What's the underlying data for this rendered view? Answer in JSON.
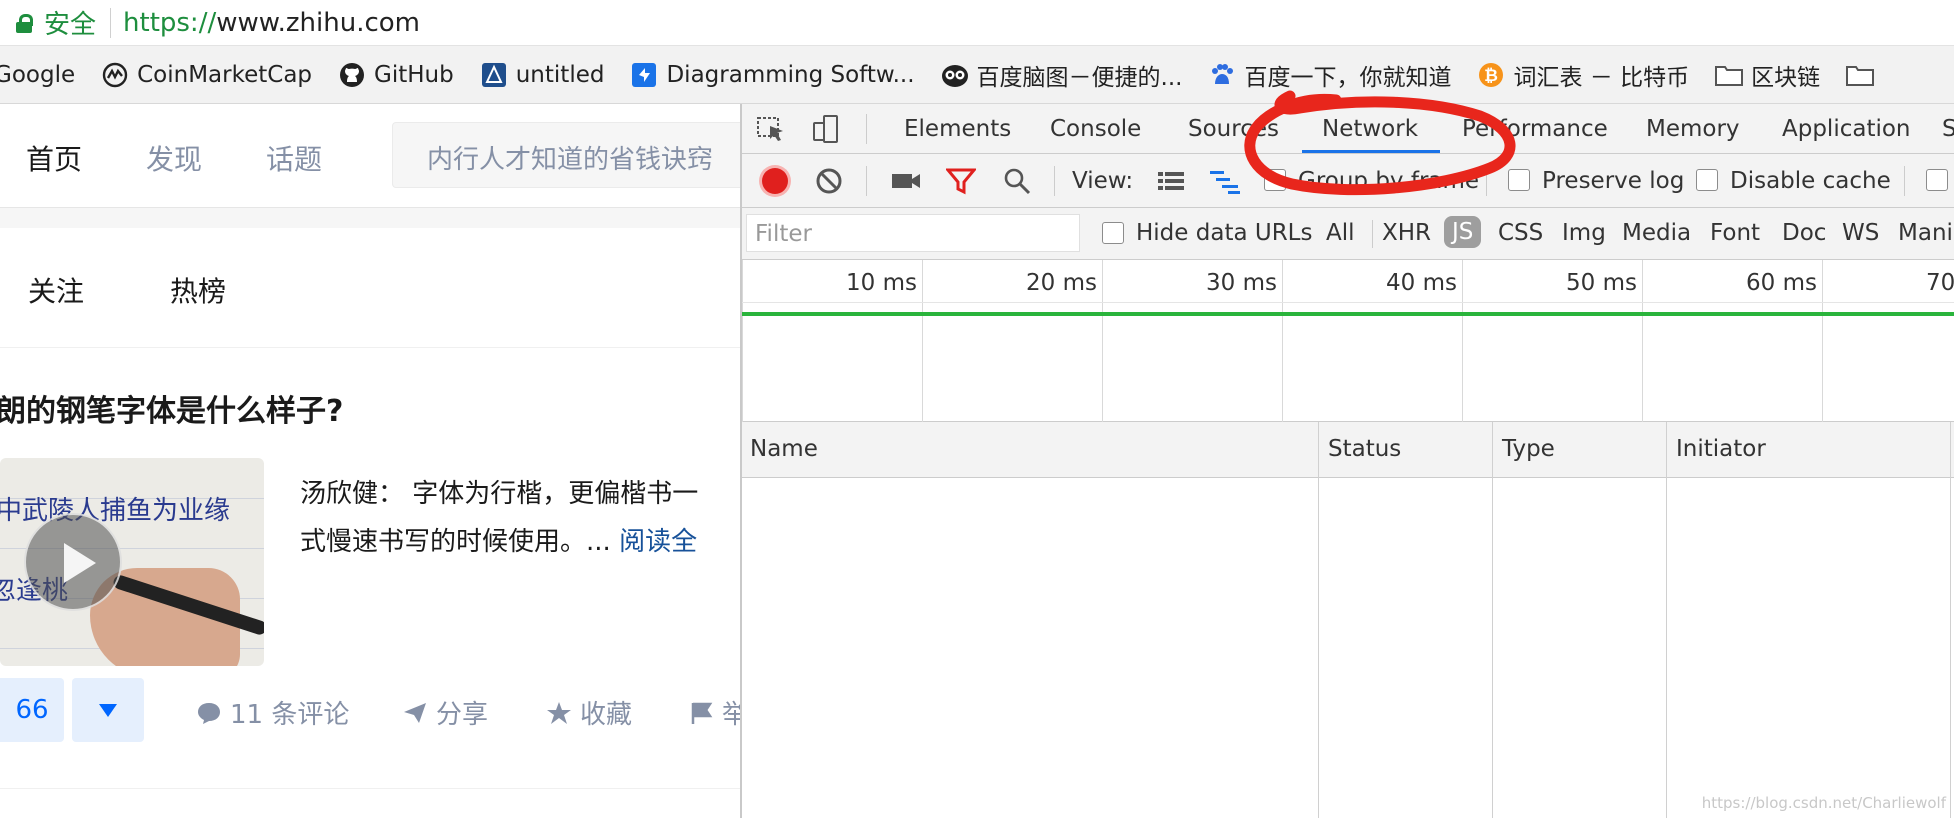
{
  "address_bar": {
    "security_label": "安全",
    "url_scheme": "https://",
    "url_rest": "www.zhihu.com"
  },
  "bookmarks": [
    {
      "label": "Google",
      "icon": "google-icon"
    },
    {
      "label": "CoinMarketCap",
      "icon": "coinmarketcap-icon"
    },
    {
      "label": "GitHub",
      "icon": "github-icon"
    },
    {
      "label": "untitled",
      "icon": "diagram-icon"
    },
    {
      "label": "Diagramming Softw...",
      "icon": "diagram-icon"
    },
    {
      "label": "百度脑图－便捷的...",
      "icon": "owl-icon"
    },
    {
      "label": "百度一下，你就知道",
      "icon": "baidu-icon"
    },
    {
      "label": "词汇表 － 比特币",
      "icon": "bitcoin-icon"
    },
    {
      "label": "区块链",
      "icon": "folder-icon"
    }
  ],
  "zhihu": {
    "nav": [
      "首页",
      "发现",
      "话题"
    ],
    "search_placeholder": "内行人才知道的省钱诀窍",
    "tabs": [
      "关注",
      "热榜"
    ],
    "question_title": "朗的钢笔字体是什么样子?",
    "excerpt_line1": "汤欣健： 字体为行楷，更偏楷书一",
    "excerpt_line2": "式慢速书写的时候使用。...",
    "read_more": "阅读全",
    "thumb_text1": "中武陵人捕鱼为业缘",
    "thumb_text2": "忽逢桃",
    "vote_count": "66",
    "actions": {
      "comments": "11 条评论",
      "share": "分享",
      "collect": "收藏",
      "report": "举"
    }
  },
  "devtools": {
    "tabs": [
      "Elements",
      "Console",
      "Sources",
      "Network",
      "Performance",
      "Memory",
      "Application",
      "S"
    ],
    "active_tab": "Network",
    "toolbar": {
      "view_label": "View:",
      "group_by_frame": "Group by frame",
      "preserve_log": "Preserve log",
      "disable_cache": "Disable cache"
    },
    "filter_placeholder": "Filter",
    "hide_data_urls": "Hide data URLs",
    "filter_types": [
      "All",
      "XHR",
      "JS",
      "CSS",
      "Img",
      "Media",
      "Font",
      "Doc",
      "WS",
      "Mani"
    ],
    "active_filter": "JS",
    "timeline_labels": [
      "10 ms",
      "20 ms",
      "30 ms",
      "40 ms",
      "50 ms",
      "60 ms",
      "70"
    ],
    "columns": [
      "Name",
      "Status",
      "Type",
      "Initiator"
    ]
  },
  "watermark": "https://blog.csdn.net/Charliewolf",
  "colors": {
    "secure_green": "#1e8e3e",
    "zhihu_blue": "#0066ff",
    "record_red": "#e0201e",
    "annotation_red": "#e8261c",
    "timeline_green": "#2ab43c",
    "active_tab_underline": "#1a73e8"
  }
}
